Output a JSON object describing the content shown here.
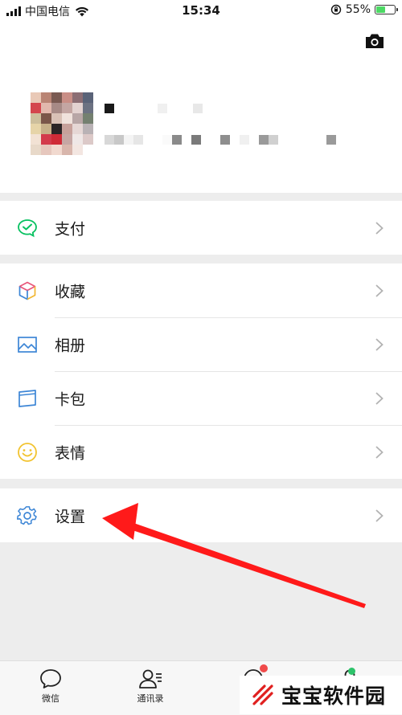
{
  "status_bar": {
    "carrier": "中国电信",
    "time": "15:34",
    "battery_percent": "55%",
    "battery_level": 0.55
  },
  "profile": {
    "nickname": "",
    "wechat_id": "",
    "avatar_pixelated": true
  },
  "menu": {
    "pay": {
      "label": "支付",
      "icon": "wechat-pay-icon",
      "color": "#07c160"
    },
    "favorites": {
      "label": "收藏",
      "icon": "cube-icon"
    },
    "album": {
      "label": "相册",
      "icon": "image-icon",
      "color": "#3d86d6"
    },
    "cards": {
      "label": "卡包",
      "icon": "card-icon",
      "color": "#3d86d6"
    },
    "stickers": {
      "label": "表情",
      "icon": "smiley-icon",
      "color": "#f2c330"
    },
    "settings": {
      "label": "设置",
      "icon": "gear-icon",
      "color": "#3d86d6"
    }
  },
  "tabbar": {
    "chats": {
      "label": "微信",
      "icon": "chat-bubble-icon"
    },
    "contacts": {
      "label": "通讯录",
      "icon": "contacts-icon"
    },
    "discover": {
      "icon": "compass-icon",
      "badge": "red-dot"
    },
    "me": {
      "icon": "person-icon",
      "badge": "green-dot"
    }
  },
  "watermark": {
    "text": "宝宝软件园",
    "logo_color": "#e0201f"
  },
  "annotation": {
    "arrow_color": "#ff1a1a",
    "points_to": "settings"
  }
}
